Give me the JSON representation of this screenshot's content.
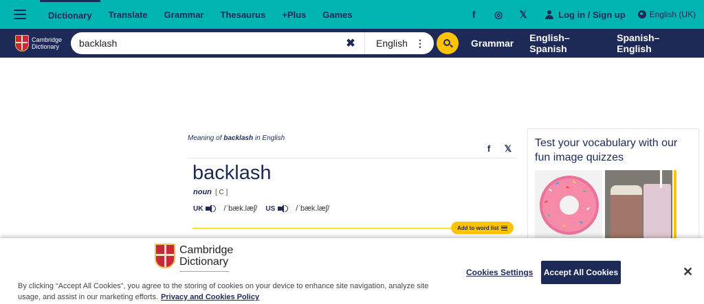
{
  "topbar": {
    "nav": [
      "Dictionary",
      "Translate",
      "Grammar",
      "Thesaurus",
      "+Plus",
      "Games"
    ],
    "social": {
      "facebook": "f",
      "instagram": "◎",
      "x": "𝕏"
    },
    "login_label": "Log in / Sign up",
    "language_label": "English (UK)"
  },
  "searchbar": {
    "logo_text_1": "Cambridge",
    "logo_text_2": "Dictionary",
    "query": "backlash",
    "clear_glyph": "✖",
    "dictionary": "English",
    "dots_glyph": "⋮",
    "quicklinks": [
      "Grammar",
      "English–Spanish",
      "Spanish–English"
    ]
  },
  "entry": {
    "meaning_prefix": "Meaning of ",
    "meaning_word": "backlash",
    "meaning_suffix": " in English",
    "share_facebook": "f",
    "share_x": "𝕏",
    "headword": "backlash",
    "pos": "noun",
    "grammar": "[ C ]",
    "uk_label": "UK",
    "uk_ipa": "/ˈbæk.læʃ/",
    "us_label": "US",
    "us_ipa": "/ˈbæk.læʃ/",
    "add_to_word_list": "Add to word list"
  },
  "sidebar": {
    "quiz_title": "Test your vocabulary with our fun image quizzes"
  },
  "cookie": {
    "logo_text_1": "Cambridge",
    "logo_text_2": "Dictionary",
    "text": "By clicking “Accept All Cookies”, you agree to the storing of cookies on your device to enhance site navigation, analyze site usage, and assist in our marketing efforts.",
    "policy_link": "Privacy and Cookies Policy",
    "settings_label": "Cookies Settings",
    "accept_label": "Accept All Cookies",
    "close_glyph": "✕"
  },
  "colors": {
    "teal": "#00b4b2",
    "navy": "#1d2a57",
    "yellow": "#fec400"
  }
}
